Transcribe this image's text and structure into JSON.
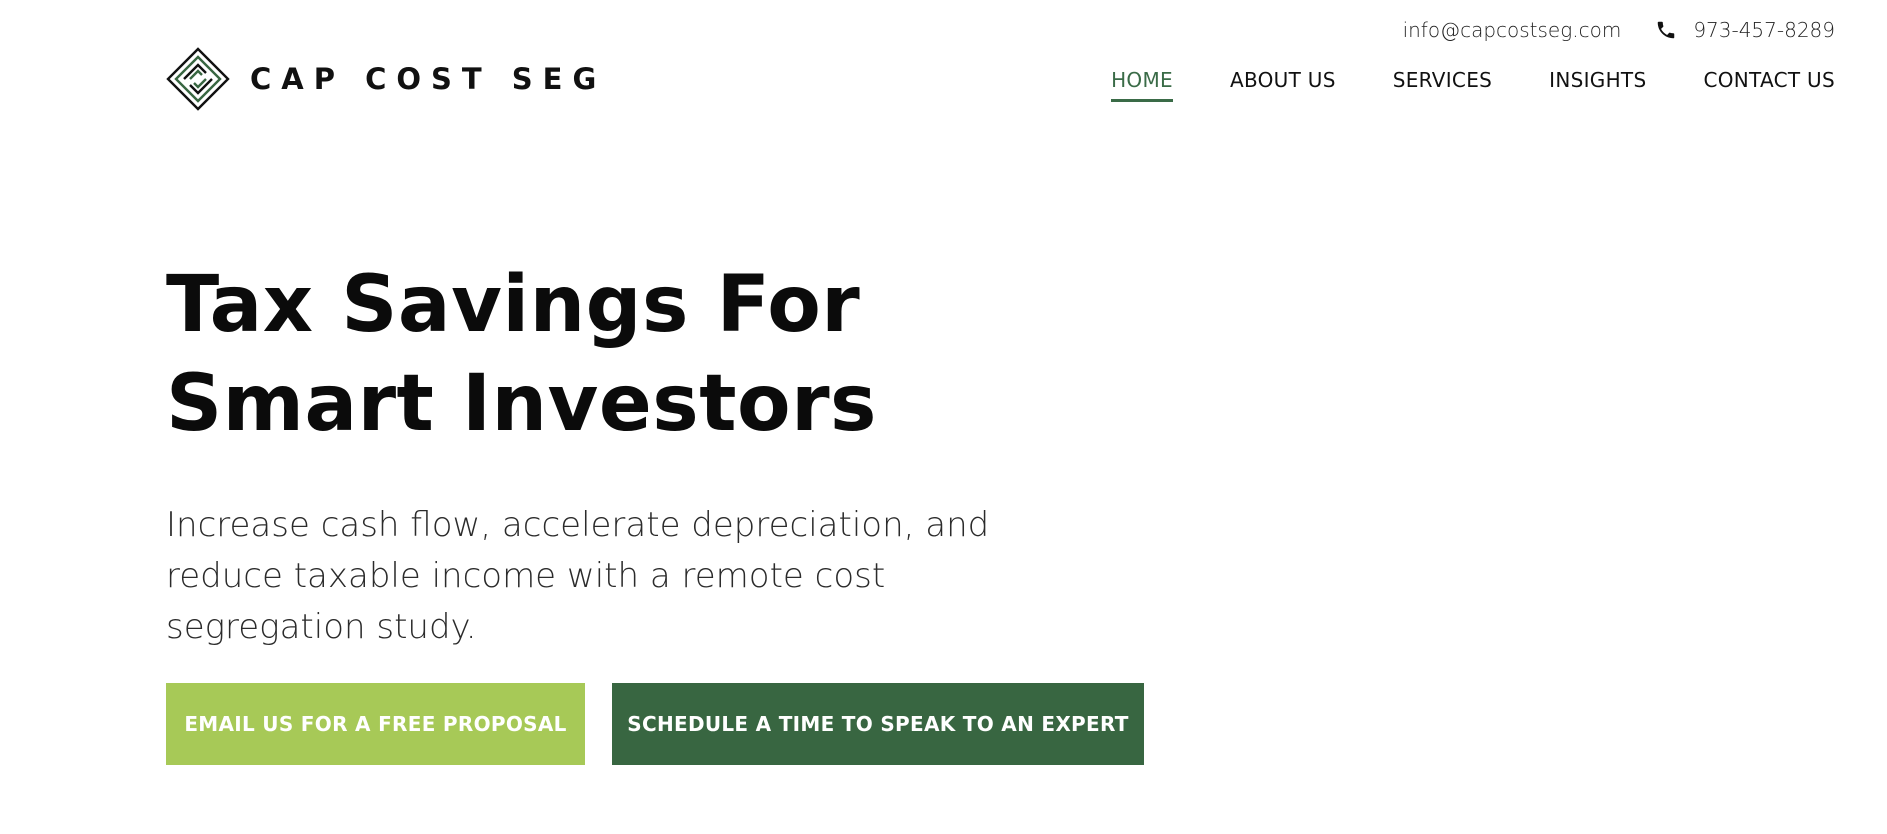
{
  "header": {
    "email": "info@capcostseg.com",
    "phone": "973-457-8289",
    "phone_icon": "phone-icon"
  },
  "logo": {
    "text": "CAP COST SEG",
    "icon": "diamond-logo-icon",
    "colors": {
      "dark": "#111111",
      "green": "#386641"
    }
  },
  "nav": {
    "items": [
      {
        "label": "HOME",
        "active": true
      },
      {
        "label": "ABOUT US",
        "active": false
      },
      {
        "label": "SERVICES",
        "active": false
      },
      {
        "label": "INSIGHTS",
        "active": false
      },
      {
        "label": "CONTACT US",
        "active": false
      }
    ],
    "active_color": "#3a6b47"
  },
  "hero": {
    "title_line1": "Tax Savings For",
    "title_line2": "Smart Investors",
    "subtitle": "Increase cash flow, accelerate depreciation, and reduce taxable income with a remote cost segregation study."
  },
  "buttons": {
    "email_label": "EMAIL US FOR A FREE PROPOSAL",
    "email_color": "#a7c957",
    "schedule_label": "SCHEDULE A TIME TO SPEAK TO AN EXPERT",
    "schedule_color": "#386641"
  }
}
